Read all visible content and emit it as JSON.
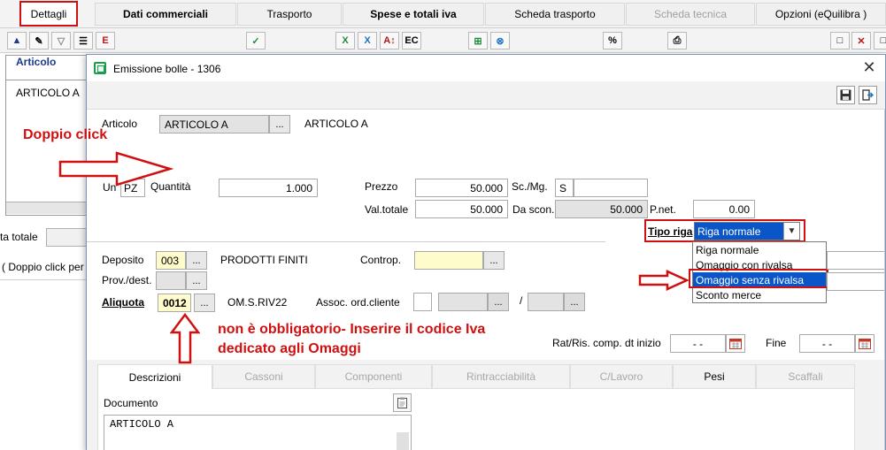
{
  "background_tabs": [
    {
      "label": "Dettagli",
      "active": true
    },
    {
      "label": "Dati commerciali",
      "bold": true
    },
    {
      "label": "Trasporto"
    },
    {
      "label": "Spese e totali iva",
      "bold": true
    },
    {
      "label": "Scheda trasporto"
    },
    {
      "label": "Scheda tecnica",
      "disabled": true
    },
    {
      "label": "Opzioni (eQuilibra )"
    }
  ],
  "background_toolbar_glyphs": [
    "▲",
    "✎",
    "▽",
    "☰",
    "E",
    "✓",
    "X",
    "X",
    "A↕",
    "EC",
    "⊞",
    "⊗",
    "%",
    "⎙",
    "□",
    "✕",
    "□"
  ],
  "background_grid": {
    "header": "Articolo",
    "row_value": "ARTICOLO A",
    "totale_label": "ta totale",
    "hint": "( Doppio click per"
  },
  "dialog": {
    "title": "Emissione bolle - 1306",
    "articolo_label": "Articolo",
    "articolo_code": "ARTICOLO A",
    "articolo_desc": "ARTICOLO A",
    "um_label": "Un",
    "um_value": "PZ",
    "quantita_label": "Quantità",
    "quantita_value": "1.000",
    "prezzo_label": "Prezzo",
    "prezzo_value": "50.000",
    "scmg_label": "Sc./Mg.",
    "scmg_value": "S",
    "valtotale_label": "Val.totale",
    "valtotale_value": "50.000",
    "dascon_label": "Da scon.",
    "dascon_value": "50.000",
    "pnet_label": "P.net.",
    "pnet_value": "0.00",
    "tiporiga_label": "Tipo riga",
    "tiporiga_value": "Riga normale",
    "tiporiga_options": [
      "Riga normale",
      "Omaggio con rivalsa",
      "Omaggio senza rivalsa",
      "Sconto merce"
    ],
    "tiporiga_highlighted": "Omaggio senza rivalsa",
    "deposito_label": "Deposito",
    "deposito_code": "003",
    "deposito_desc": "PRODOTTI FINITI",
    "controp_label": "Controp.",
    "provdest_label": "Prov./dest.",
    "aliquota_label": "Aliquota",
    "aliquota_code": "0012",
    "aliquota_desc": "OM.S.RIV22",
    "assoc_label": "Assoc. ord.cliente",
    "slash": "/",
    "rat_label": "Rat/Ris. comp. dt inizio",
    "rat_value": "- -",
    "fine_label": "Fine",
    "fine_value": "- -",
    "dots": "...",
    "subtabs": [
      {
        "label": "Descrizioni",
        "active": true
      },
      {
        "label": "Cassoni"
      },
      {
        "label": "Componenti"
      },
      {
        "label": "Rintracciabilità"
      },
      {
        "label": "C/Lavoro"
      },
      {
        "label": "Pesi",
        "dark": true
      },
      {
        "label": "Scaffali"
      }
    ],
    "documento_label": "Documento",
    "documento_text": "ARTICOLO A"
  },
  "annotations": {
    "doppio_click": "Doppio click",
    "note_line1": "non è obbligatorio- Inserire il codice Iva",
    "note_line2": "dedicato agli Omaggi"
  },
  "colors": {
    "annotation_red": "#d01010",
    "selection_blue": "#0a56c8",
    "required_yellow": "#fffccc"
  }
}
